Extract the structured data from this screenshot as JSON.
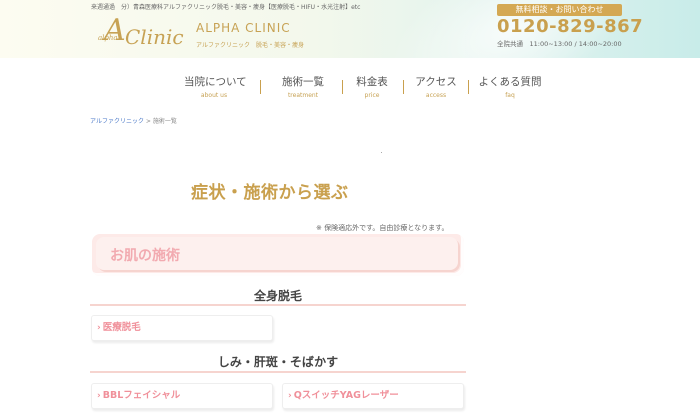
{
  "header": {
    "tagline": "来週通過　分）青森医療科アルファクリニック脱毛・美容・痩身【医療脱毛・HIFU・水光注射】etc",
    "logo_small": "alpha",
    "logo_big_letter": "A",
    "logo_word": "Clinic",
    "logo_en": "ALPHA CLINIC",
    "logo_jp": "アルファクリニック　脱毛・美容・痩身",
    "contact_badge": "無料相談・お問い合わせ",
    "phone": "0120-829-867",
    "hours": "全院共通　11:00~13:00 / 14:00~20:00"
  },
  "nav": {
    "items": [
      {
        "jp": "当院について",
        "en": "about us"
      },
      {
        "jp": "施術一覧",
        "en": "treatment"
      },
      {
        "jp": "料金表",
        "en": "price"
      },
      {
        "jp": "アクセス",
        "en": "access"
      },
      {
        "jp": "よくある質問",
        "en": "faq"
      }
    ]
  },
  "breadcrumb": {
    "home": "アルファクリニック",
    "separator": ">",
    "current": "施術一覧"
  },
  "page_title": "症状・施術から選ぶ",
  "note": "※ 保険適応外です。自由診療となります。",
  "section": {
    "label": "お肌の施術"
  },
  "categories": [
    {
      "title": "全身脱毛",
      "items": [
        "医療脱毛"
      ]
    },
    {
      "title": "しみ・肝斑・そばかす",
      "items": [
        "BBLフェイシャル",
        "QスイッチYAGレーザー"
      ]
    }
  ],
  "colors": {
    "gold": "#c9a04e",
    "pink": "#f0909a",
    "pink_bg": "#fdf0ee"
  },
  "icons": {
    "chevron": "›"
  }
}
